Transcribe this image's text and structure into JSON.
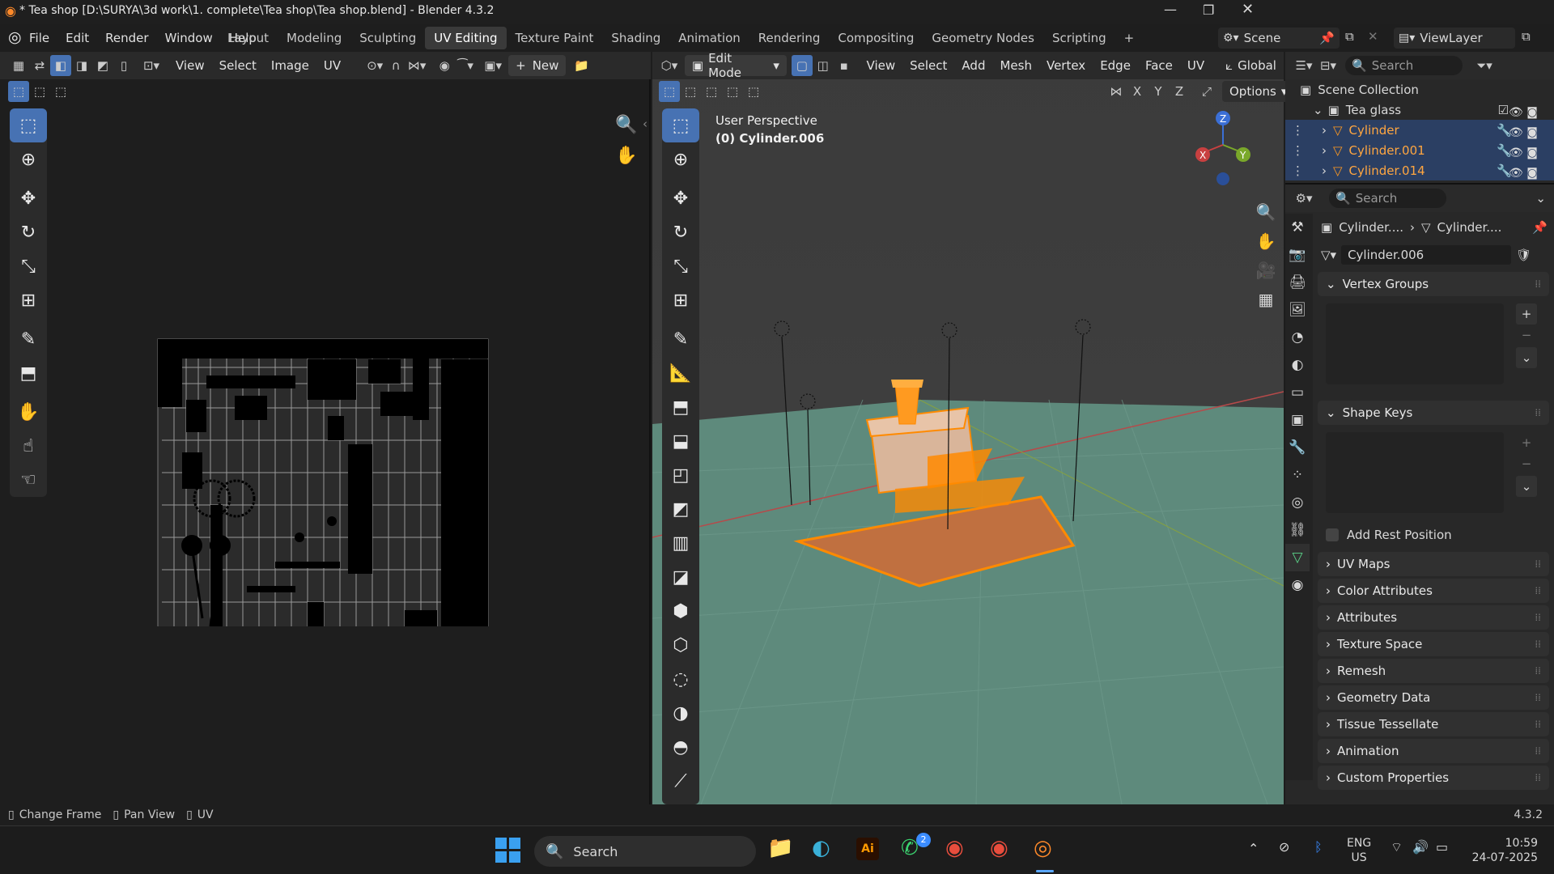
{
  "title": "* Tea shop [D:\\SURYA\\3d work\\1. complete\\Tea shop\\Tea shop.blend] - Blender 4.3.2",
  "menu": [
    "File",
    "Edit",
    "Render",
    "Window",
    "Help"
  ],
  "workspaces": [
    "Layout",
    "Modeling",
    "Sculpting",
    "UV Editing",
    "Texture Paint",
    "Shading",
    "Animation",
    "Rendering",
    "Compositing",
    "Geometry Nodes",
    "Scripting"
  ],
  "active_workspace": "UV Editing",
  "scene": "Scene",
  "view_layer": "ViewLayer",
  "uv_header": {
    "view": "View",
    "select": "Select",
    "image": "Image",
    "uv": "UV",
    "new": "New"
  },
  "vp_header": {
    "mode": "Edit Mode",
    "view": "View",
    "select": "Select",
    "add": "Add",
    "mesh": "Mesh",
    "vertex": "Vertex",
    "edge": "Edge",
    "face": "Face",
    "uv": "UV",
    "transform": "Global",
    "options": "Options",
    "x": "X",
    "y": "Y",
    "z": "Z"
  },
  "viewport": {
    "line1": "User Perspective",
    "line2": "(0) Cylinder.006"
  },
  "outliner": {
    "search": "Search",
    "root": "Scene Collection",
    "collection": "Tea glass",
    "items": [
      "Cylinder",
      "Cylinder.001",
      "Cylinder.014"
    ]
  },
  "props": {
    "search": "Search",
    "crumb1": "Cylinder....",
    "crumb2": "Cylinder....",
    "mesh_name": "Cylinder.006",
    "vertex_groups": "Vertex Groups",
    "shape_keys": "Shape Keys",
    "add_rest": "Add Rest Position",
    "panels": [
      "UV Maps",
      "Color Attributes",
      "Attributes",
      "Texture Space",
      "Remesh",
      "Geometry Data",
      "Tissue Tessellate",
      "Animation",
      "Custom Properties"
    ]
  },
  "status": {
    "a": "Change Frame",
    "b": "Pan View",
    "c": "UV",
    "version": "4.3.2"
  },
  "taskbar": {
    "search": "Search",
    "lang1": "ENG",
    "lang2": "US",
    "time": "10:59",
    "date": "24-07-2025",
    "whatsapp_badge": "2"
  },
  "colors": {
    "accent": "#4772b3",
    "selection": "#ff8a00",
    "floor": "#5e8a7c"
  }
}
